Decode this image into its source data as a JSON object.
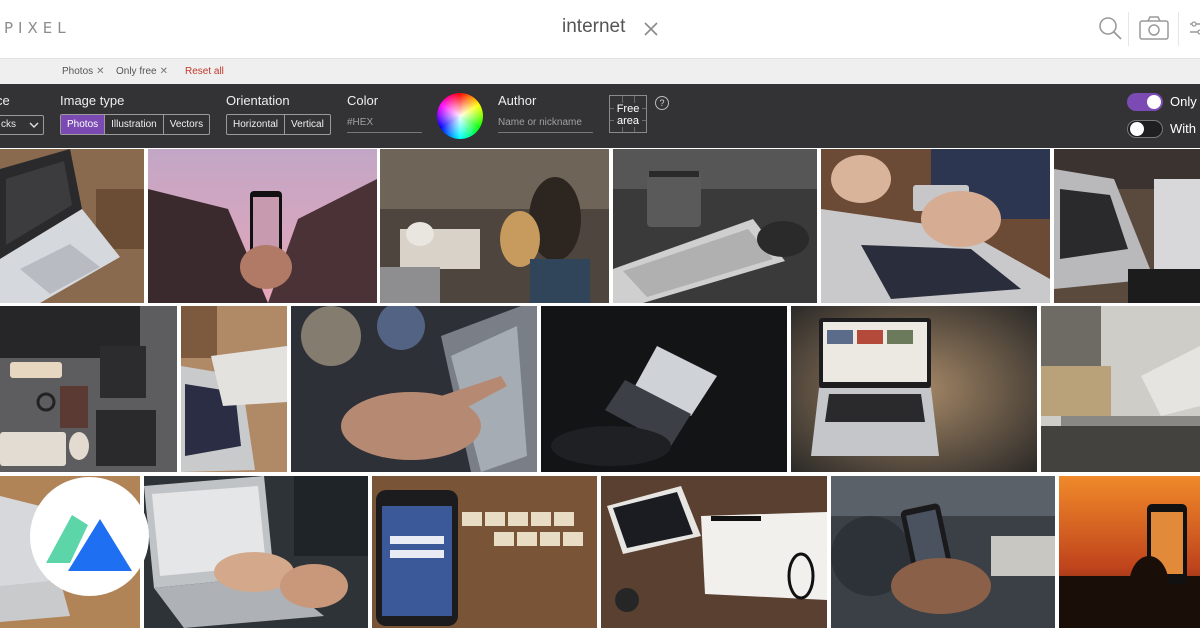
{
  "header": {
    "logo": "PIXEL",
    "search_query": "internet"
  },
  "active_filters": {
    "chips": [
      "Photos",
      "Only free"
    ],
    "reset_label": "Reset all"
  },
  "filters": {
    "source_label": "ce",
    "source_value": "cks",
    "image_type": {
      "label": "Image type",
      "options": [
        "Photos",
        "Illustration",
        "Vectors"
      ],
      "selected": "Photos"
    },
    "orientation": {
      "label": "Orientation",
      "options": [
        "Horizontal",
        "Vertical"
      ]
    },
    "color": {
      "label": "Color",
      "placeholder": "#HEX"
    },
    "author": {
      "label": "Author",
      "placeholder": "Name or nickname"
    },
    "free_area_label": "Free area",
    "help_glyph": "?",
    "toggles": [
      {
        "label": "Only",
        "on": true
      },
      {
        "label": "With",
        "on": false
      }
    ]
  },
  "icons": {
    "clear": "close-icon",
    "search": "search-icon",
    "camera": "camera-icon",
    "settings": "sliders-icon",
    "badge": "brand-logo-icon"
  },
  "colors": {
    "accent": "#7b4bb3",
    "panel": "#333336",
    "reset": "#c0392b",
    "badge_green": "#5cd6a8",
    "badge_blue": "#1e6ff2"
  }
}
